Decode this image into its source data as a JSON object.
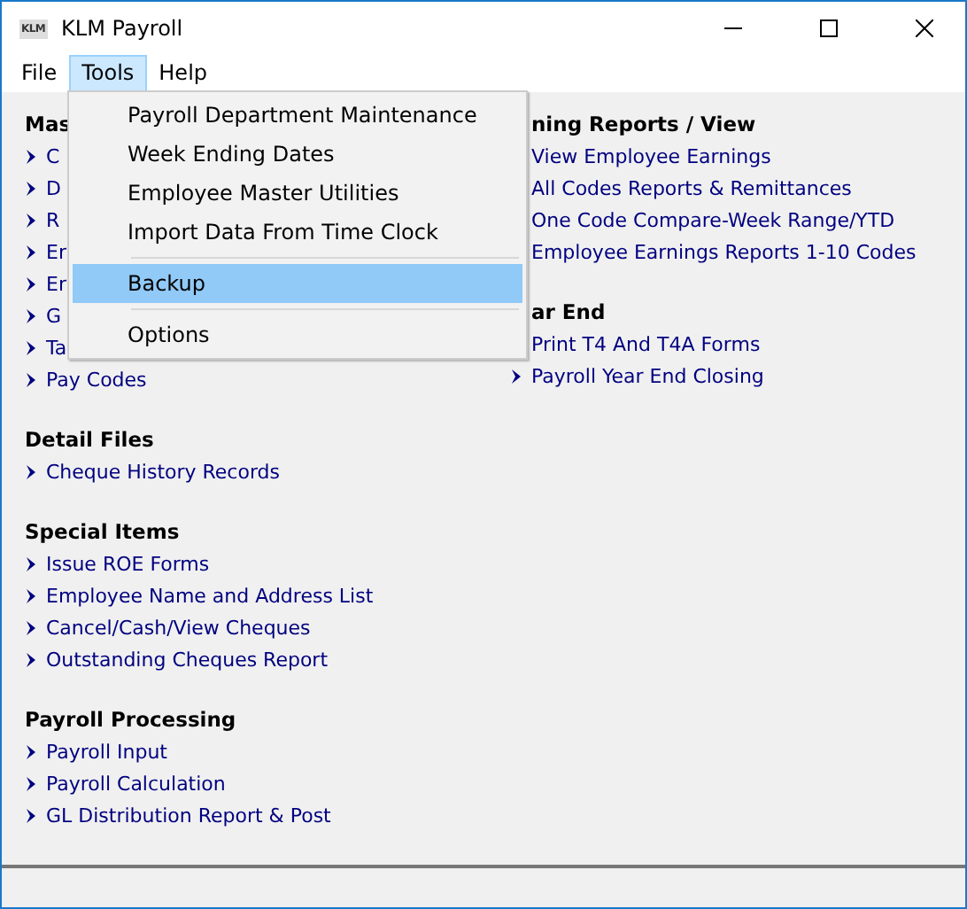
{
  "window": {
    "title": "KLM Payroll",
    "logo": "KLM"
  },
  "menubar": [
    {
      "label": "File",
      "selected": false
    },
    {
      "label": "Tools",
      "selected": true
    },
    {
      "label": "Help",
      "selected": false
    }
  ],
  "dropdown": [
    {
      "kind": "item",
      "label": "Payroll Department Maintenance",
      "selected": false
    },
    {
      "kind": "item",
      "label": "Week Ending Dates",
      "selected": false
    },
    {
      "kind": "item",
      "label": "Employee Master Utilities",
      "selected": false
    },
    {
      "kind": "item",
      "label": "Import Data From Time Clock",
      "selected": false
    },
    {
      "kind": "separator"
    },
    {
      "kind": "item",
      "label": "Backup",
      "selected": true
    },
    {
      "kind": "separator"
    },
    {
      "kind": "item",
      "label": "Options",
      "selected": false
    }
  ],
  "left_column": [
    {
      "title": "Mas",
      "items": [
        {
          "label": "C",
          "bullet": true
        },
        {
          "label": "D",
          "bullet": true
        },
        {
          "label": "R",
          "bullet": true
        },
        {
          "label": "Er",
          "bullet": true
        },
        {
          "label": "Er",
          "bullet": true
        },
        {
          "label": "G",
          "bullet": true
        },
        {
          "label": "Ta",
          "bullet": true
        },
        {
          "label": "Pay Codes",
          "bullet": true
        }
      ]
    },
    {
      "title": "Detail Files",
      "items": [
        {
          "label": "Cheque History Records",
          "bullet": true
        }
      ]
    },
    {
      "title": "Special Items",
      "items": [
        {
          "label": "Issue ROE Forms",
          "bullet": true
        },
        {
          "label": "Employee Name and Address List",
          "bullet": true
        },
        {
          "label": "Cancel/Cash/View Cheques",
          "bullet": true
        },
        {
          "label": "Outstanding Cheques Report",
          "bullet": true
        }
      ]
    },
    {
      "title": "Payroll Processing",
      "items": [
        {
          "label": "Payroll Input",
          "bullet": true
        },
        {
          "label": "Payroll Calculation",
          "bullet": true
        },
        {
          "label": "GL Distribution Report & Post",
          "bullet": true
        }
      ]
    }
  ],
  "right_column": [
    {
      "title": "ning Reports / View",
      "items": [
        {
          "label": "View Employee Earnings",
          "bullet": false
        },
        {
          "label": "All Codes Reports & Remittances",
          "bullet": false
        },
        {
          "label": "One Code Compare-Week Range/YTD",
          "bullet": false
        },
        {
          "label": "Employee Earnings Reports 1-10 Codes",
          "bullet": false
        }
      ]
    },
    {
      "title": "ar End",
      "items": [
        {
          "label": "Print T4 And T4A Forms",
          "bullet": false
        },
        {
          "label": "Payroll Year End Closing",
          "bullet": true
        }
      ]
    }
  ]
}
